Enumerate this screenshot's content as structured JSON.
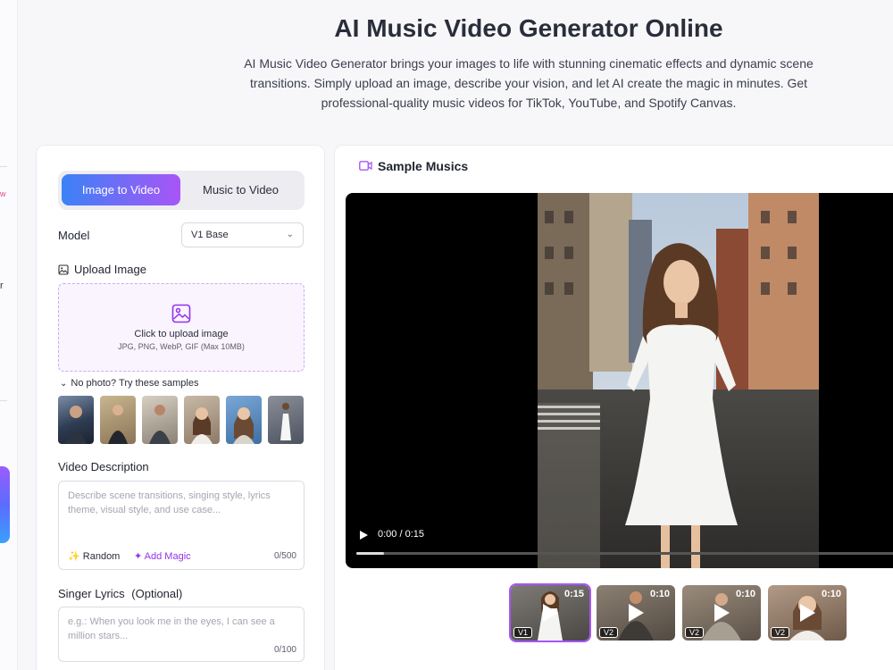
{
  "header": {
    "title": "AI Music Video Generator Online",
    "subtitle": "AI Music Video Generator brings your images to life with stunning cinematic effects and dynamic scene transitions. Simply upload an image, describe your vision, and let AI create the magic in minutes. Get professional-quality music videos for TikTok, YouTube, and Spotify Canvas."
  },
  "sidebar_edge": {
    "partial_labels": [
      "w",
      "r"
    ]
  },
  "tabs": [
    {
      "label": "Image to Video",
      "active": true
    },
    {
      "label": "Music to Video",
      "active": false
    }
  ],
  "model": {
    "label": "Model",
    "selected": "V1 Base",
    "icon": "chevron-down-icon"
  },
  "upload": {
    "label": "Upload Image",
    "cta": "Click to upload image",
    "formats": "JPG, PNG, WebP, GIF (Max 10MB)"
  },
  "samples": {
    "toggle_label": "No photo? Try these samples",
    "count": 6
  },
  "description": {
    "label": "Video Description",
    "placeholder": "Describe scene transitions, singing style, lyrics theme, visual style, and use case...",
    "random_label": "Random",
    "magic_label": "Add Magic",
    "counter": "0/500"
  },
  "lyrics": {
    "label": "Singer Lyrics",
    "optional": "(Optional)",
    "placeholder": "e.g.: When you look me in the eyes, I can see a million stars...",
    "counter": "0/100"
  },
  "sample_musics": {
    "title": "Sample Musics",
    "player": {
      "time": "0:00 / 0:15",
      "progress": 0.05
    },
    "thumbnails": [
      {
        "duration": "0:15",
        "version": "V1",
        "selected": true
      },
      {
        "duration": "0:10",
        "version": "V2",
        "selected": false
      },
      {
        "duration": "0:10",
        "version": "V2",
        "selected": false
      },
      {
        "duration": "0:10",
        "version": "V2",
        "selected": false
      }
    ]
  },
  "colors": {
    "accent_start": "#3b82f6",
    "accent_end": "#a855f7",
    "upload_border": "#d3a7f5",
    "magic": "#9333ea"
  }
}
